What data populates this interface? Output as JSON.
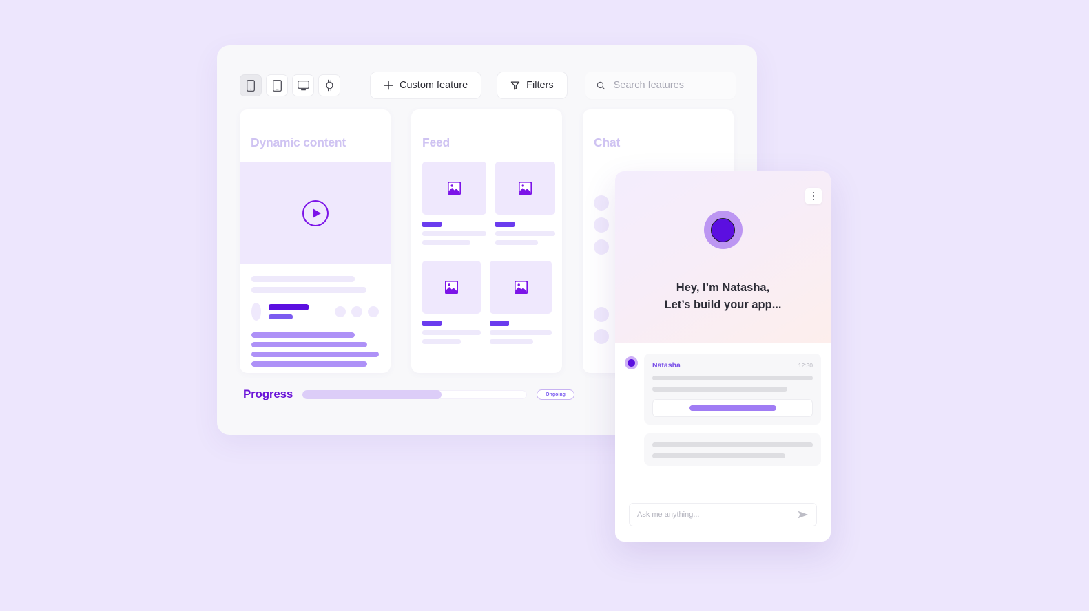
{
  "toolbar": {
    "devices": [
      {
        "name": "phone",
        "label": "Phone",
        "active": true
      },
      {
        "name": "tablet",
        "label": "Tablet",
        "active": false
      },
      {
        "name": "desktop",
        "label": "Desktop",
        "active": false
      },
      {
        "name": "watch",
        "label": "Watch",
        "active": false
      }
    ],
    "custom_feature_label": "Custom feature",
    "filters_label": "Filters",
    "search_placeholder": "Search features",
    "search_value": ""
  },
  "cards": [
    {
      "title": "Dynamic content"
    },
    {
      "title": "Feed"
    },
    {
      "title": "Chat"
    }
  ],
  "progress": {
    "label": "Progress",
    "percent": 62,
    "status_badge": "Ongoing"
  },
  "widget": {
    "greeting_line1": "Hey, I’m Natasha,",
    "greeting_line2": "Let’s build your app...",
    "menu_icon": "kebab-menu-icon",
    "message": {
      "sender": "Natasha",
      "time": "12:30"
    },
    "composer_placeholder": "Ask me anything...",
    "composer_value": "",
    "send_icon": "send-arrow-icon"
  },
  "colors": {
    "background": "#EDE6FD",
    "panel": "#F8F8FA",
    "accent": "#5B0FE0",
    "accent_light": "#A07CF4",
    "title_muted": "#CFC3F2",
    "progress_fill": "#DCCDF8"
  }
}
